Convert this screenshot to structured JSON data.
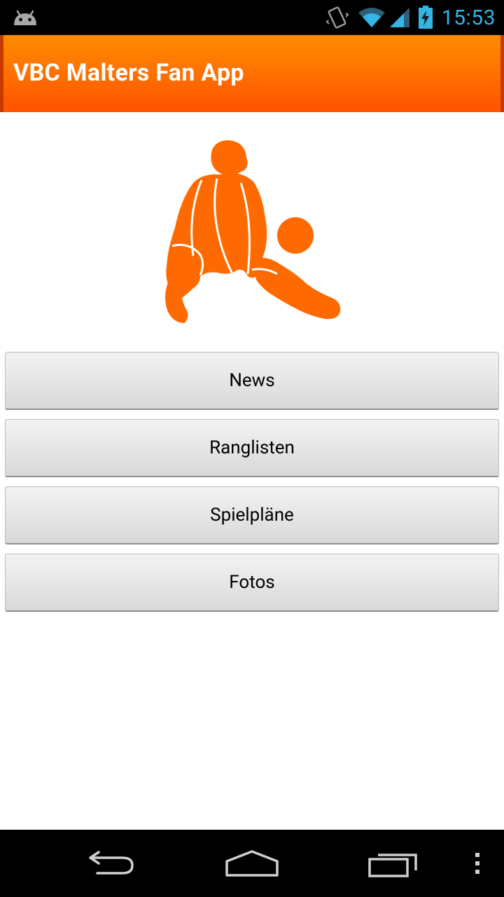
{
  "status_bar": {
    "time": "15:53",
    "icons": [
      "android-debug-icon",
      "vibrate-icon",
      "wifi-icon",
      "signal-icon",
      "battery-charging-icon"
    ],
    "clock_color": "#33b5e5"
  },
  "action_bar": {
    "title": "VBC Malters Fan App",
    "color_top": "#ff8c00",
    "color_bottom": "#ff5200"
  },
  "logo": {
    "icon": "volleyball-player-icon",
    "color": "#ff6a00"
  },
  "menu": {
    "buttons": [
      {
        "label": "News"
      },
      {
        "label": "Ranglisten"
      },
      {
        "label": "Spielpläne"
      },
      {
        "label": "Fotos"
      }
    ]
  },
  "nav_bar": {
    "buttons": [
      "back-icon",
      "home-icon",
      "recents-icon",
      "overflow-menu-icon"
    ]
  }
}
